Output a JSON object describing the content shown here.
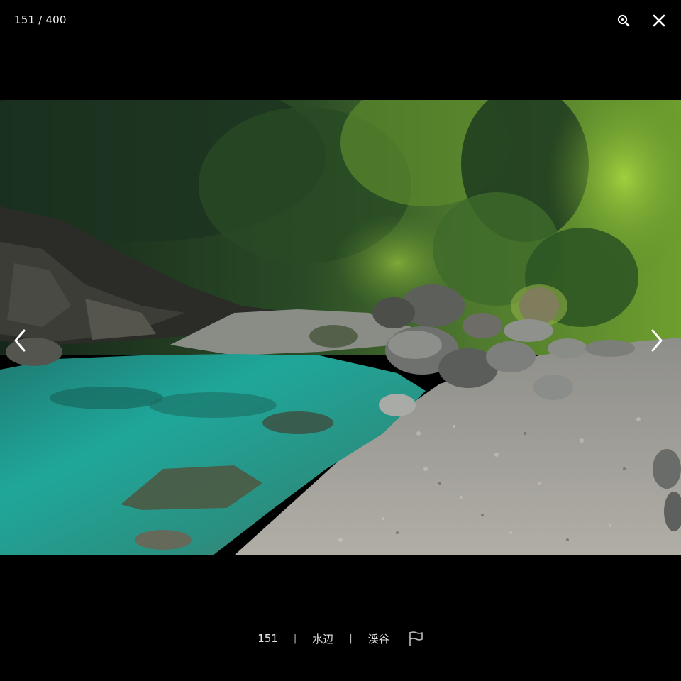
{
  "header": {
    "counter": "151 / 400",
    "zoom_icon": "zoom-in-icon",
    "close_icon": "close-icon"
  },
  "photo": {
    "subject": "river-gorge-photo"
  },
  "navigation": {
    "prev_icon": "chevron-left-icon",
    "next_icon": "chevron-right-icon"
  },
  "caption": {
    "number": "151",
    "separator": "|",
    "tag_1": "水辺",
    "tag_2": "渓谷",
    "flag_icon": "flag-icon"
  },
  "colors": {
    "background": "#000000",
    "text": "#ffffff"
  }
}
